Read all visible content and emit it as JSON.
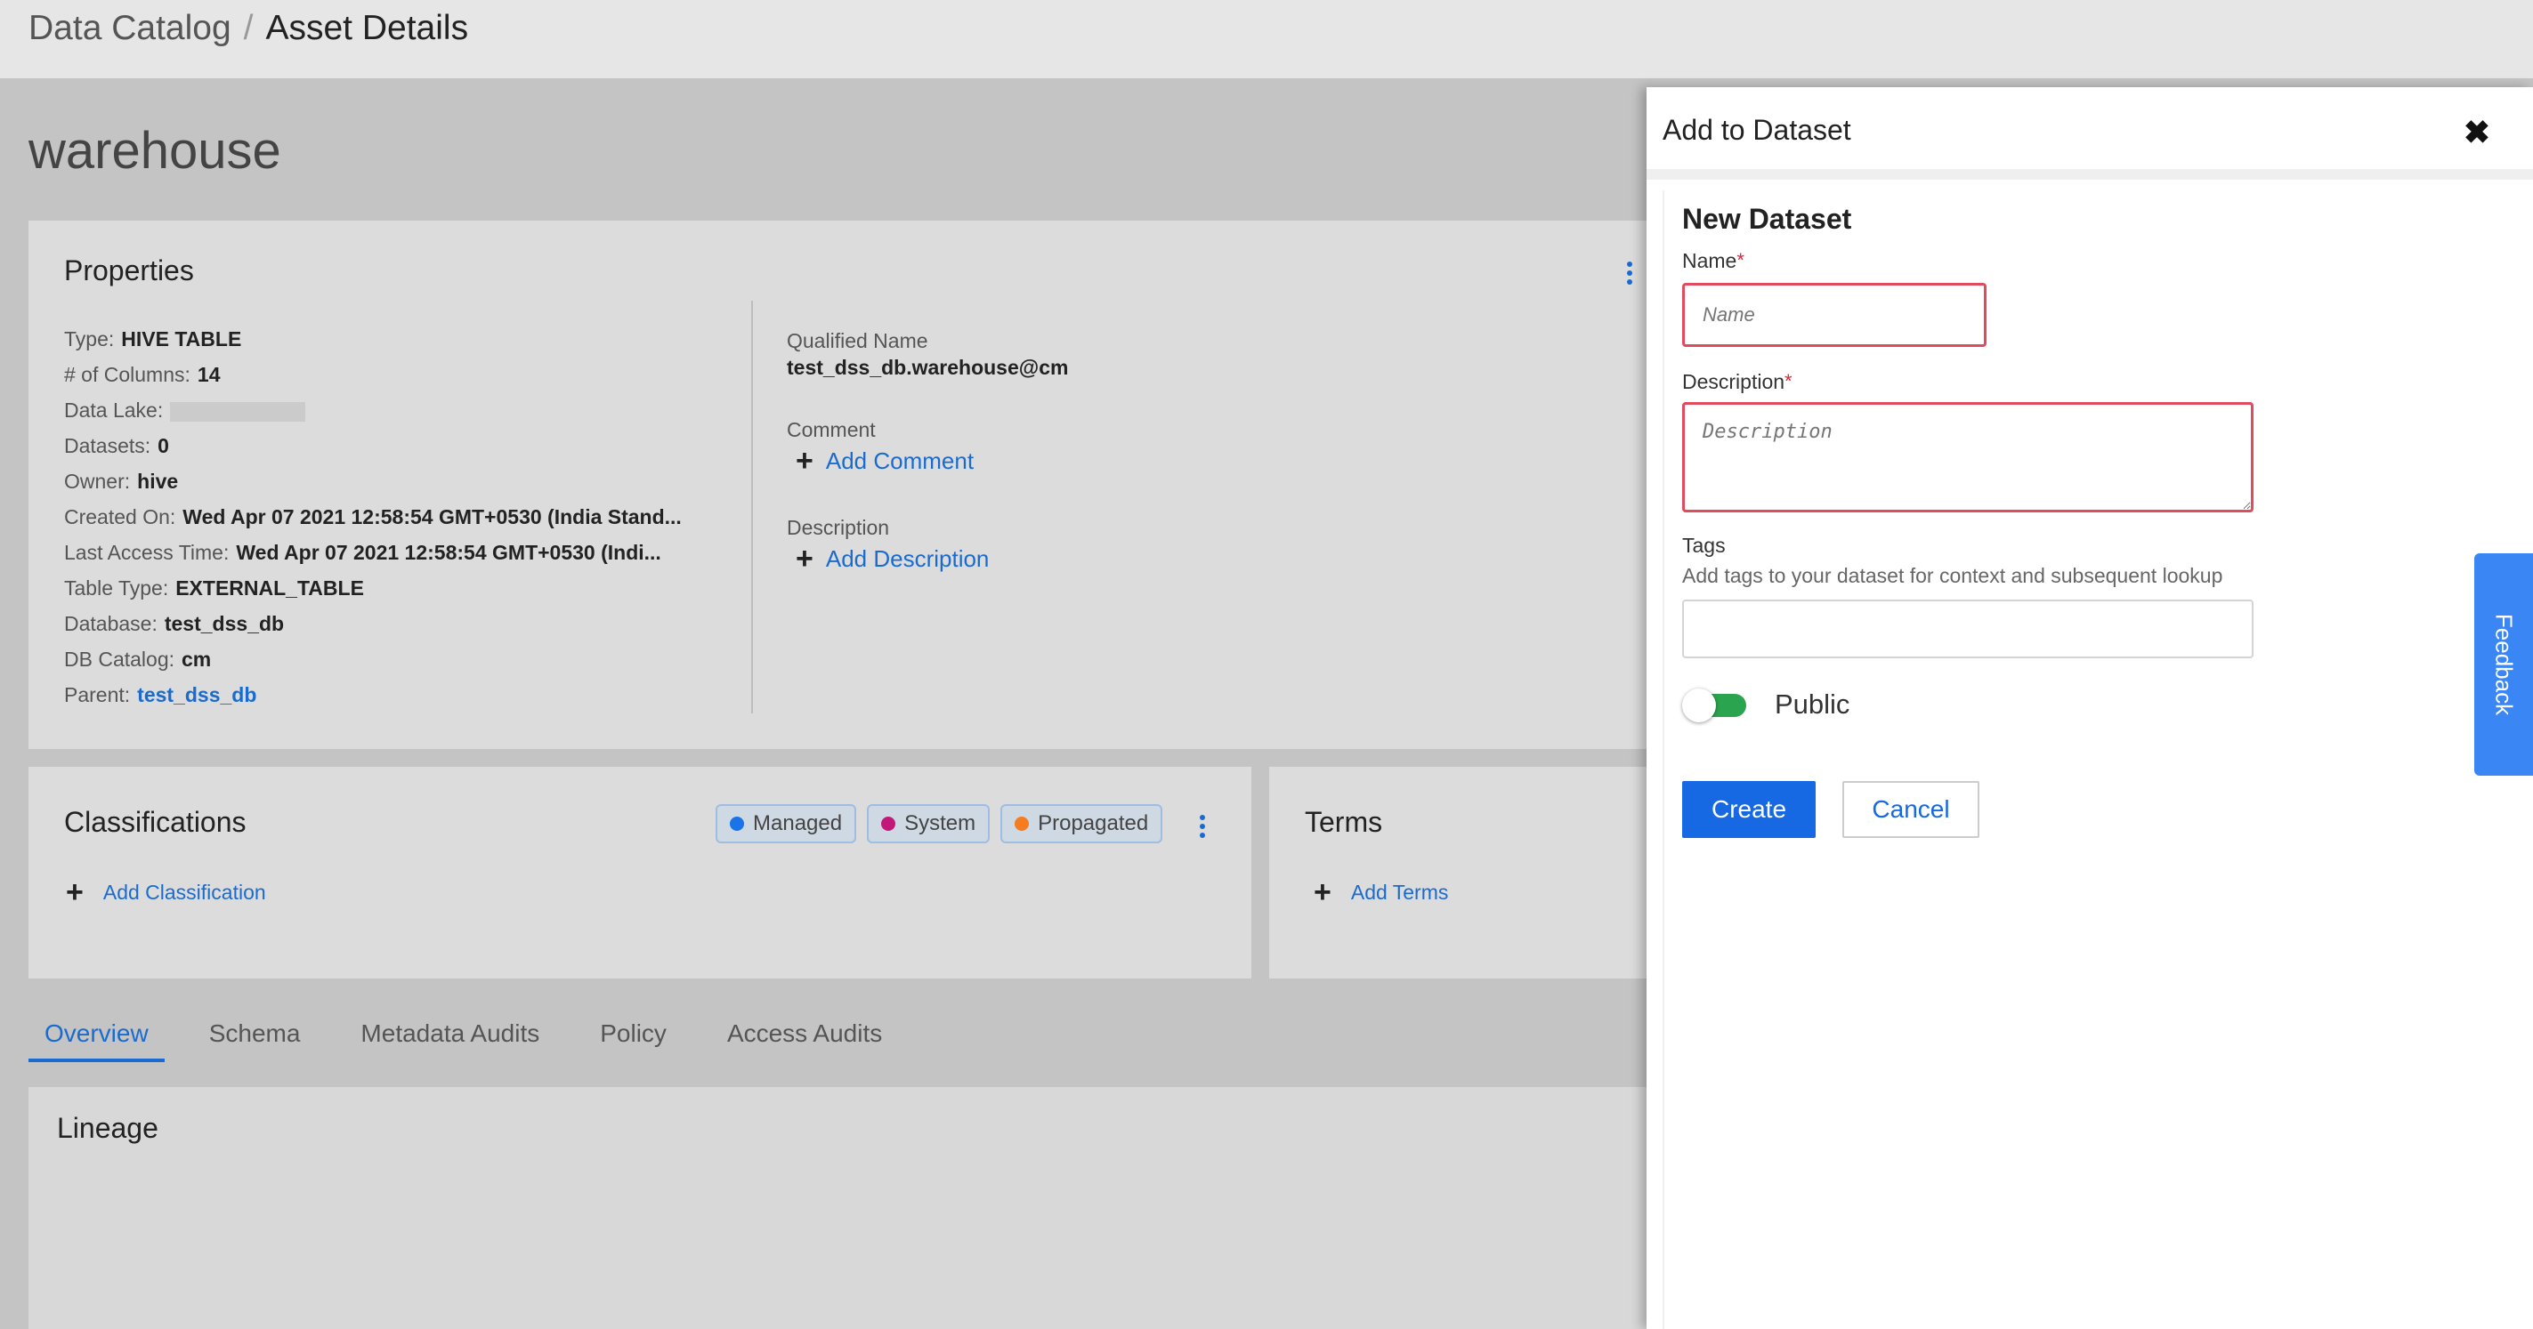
{
  "breadcrumb": {
    "root": "Data Catalog",
    "separator": "/",
    "current": "Asset Details"
  },
  "asset_title": "warehouse",
  "properties": {
    "title": "Properties",
    "rows": [
      {
        "key": "Type:",
        "value": "HIVE TABLE"
      },
      {
        "key": "# of Columns:",
        "value": "14"
      },
      {
        "key": "Data Lake:",
        "value": ""
      },
      {
        "key": "Datasets:",
        "value": "0"
      },
      {
        "key": "Owner:",
        "value": "hive"
      },
      {
        "key": "Created On:",
        "value": "Wed Apr 07 2021 12:58:54 GMT+0530 (India Stand..."
      },
      {
        "key": "Last Access Time:",
        "value": "Wed Apr 07 2021 12:58:54 GMT+0530 (Indi..."
      },
      {
        "key": "Table Type:",
        "value": "EXTERNAL_TABLE"
      },
      {
        "key": "Database:",
        "value": "test_dss_db"
      },
      {
        "key": "DB Catalog:",
        "value": "cm"
      },
      {
        "key": "Parent:",
        "value": "test_dss_db"
      }
    ],
    "qualified_name_label": "Qualified Name",
    "qualified_name_value": "test_dss_db.warehouse@cm",
    "comment_label": "Comment",
    "add_comment": "Add Comment",
    "description_label": "Description",
    "add_description": "Add Description"
  },
  "classifications": {
    "title": "Classifications",
    "badges": [
      {
        "label": "Managed",
        "color": "#1a73e8"
      },
      {
        "label": "System",
        "color": "#c2187a"
      },
      {
        "label": "Propagated",
        "color": "#f57c1f"
      }
    ],
    "add_label": "Add Classification"
  },
  "terms": {
    "title": "Terms",
    "add_label": "Add Terms"
  },
  "tabs": [
    {
      "label": "Overview",
      "active": true
    },
    {
      "label": "Schema",
      "active": false
    },
    {
      "label": "Metadata Audits",
      "active": false
    },
    {
      "label": "Policy",
      "active": false
    },
    {
      "label": "Access Audits",
      "active": false
    }
  ],
  "lineage": {
    "title": "Lineage"
  },
  "panel": {
    "title": "Add to Dataset",
    "close_glyph": "✖",
    "section_title": "New Dataset",
    "name_label": "Name",
    "name_placeholder": "Name",
    "description_label": "Description",
    "description_placeholder": "Description",
    "required_mark": "*",
    "tags_label": "Tags",
    "tags_help": "Add tags to your dataset for context and subsequent lookup",
    "public_label": "Public",
    "create_label": "Create",
    "cancel_label": "Cancel"
  },
  "feedback_label": "Feedback"
}
